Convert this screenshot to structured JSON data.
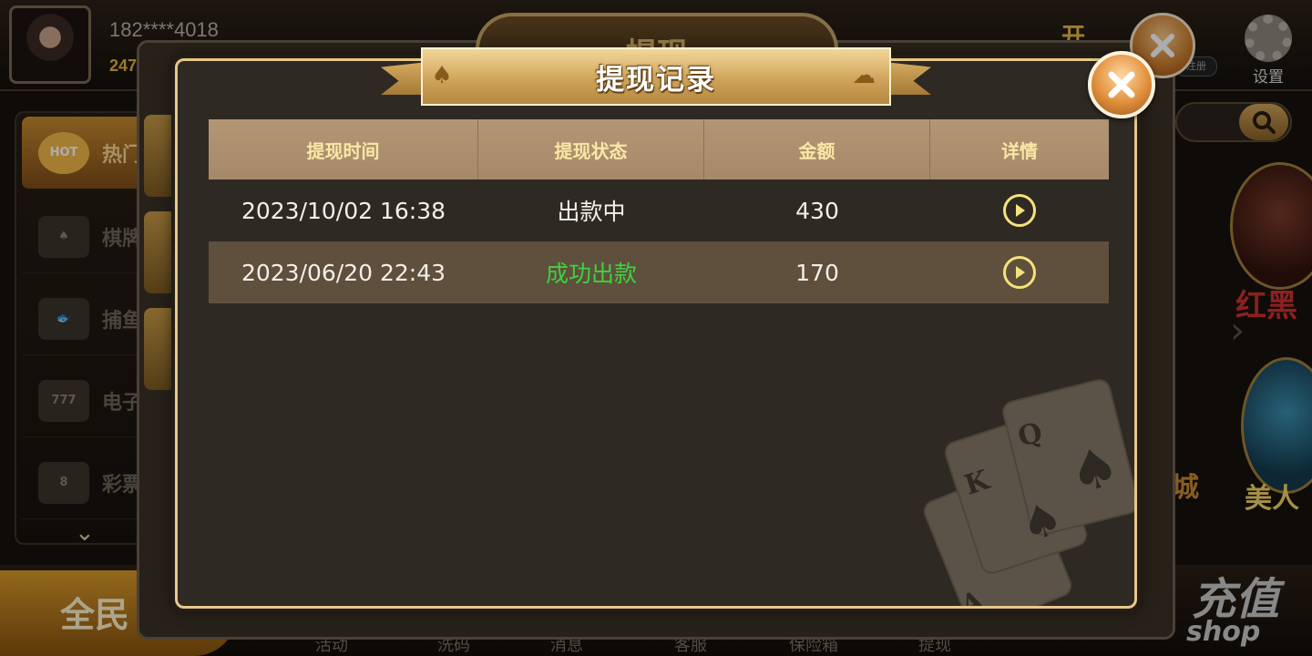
{
  "background": {
    "user_id": "182****4018",
    "user_balance": "247",
    "title_tab": "提现",
    "logo_text": "开",
    "logo_badge": "注册",
    "settings_label": "设置",
    "sidebar_items": [
      {
        "label": "热门",
        "icon": "hot-icon",
        "icon_text": "HOT"
      },
      {
        "label": "棋牌",
        "icon": "cards-icon",
        "icon_text": "♠"
      },
      {
        "label": "捕鱼",
        "icon": "fish-icon",
        "icon_text": "🐟"
      },
      {
        "label": "电子",
        "icon": "slot-icon",
        "icon_text": "777"
      },
      {
        "label": "彩票",
        "icon": "lottery-icon",
        "icon_text": "8"
      }
    ],
    "game_label_1": "红黑",
    "game_label_2": "美人",
    "game_label_3": "城",
    "bottom_left_text": "全民",
    "bottom_right_text": "充值",
    "bottom_right_shop": "shop",
    "bottom_nav": [
      "活动",
      "洗码",
      "消息",
      "客服",
      "保险箱",
      "提现"
    ]
  },
  "modal": {
    "title": "提现记录",
    "close_icon": "close-icon",
    "columns": [
      "提现时间",
      "提现状态",
      "金额",
      "详情"
    ],
    "rows": [
      {
        "time": "2023/10/02 16:38",
        "status": "出款中",
        "amount": "430",
        "status_color": "#f3efe9"
      },
      {
        "time": "2023/06/20 22:43",
        "status": "成功出款",
        "amount": "170",
        "status_color": "#3fd23f"
      }
    ]
  },
  "colors": {
    "accent_gold": "#e7c88a",
    "header_text": "#fbe7a5",
    "success_green": "#3fd23f"
  }
}
